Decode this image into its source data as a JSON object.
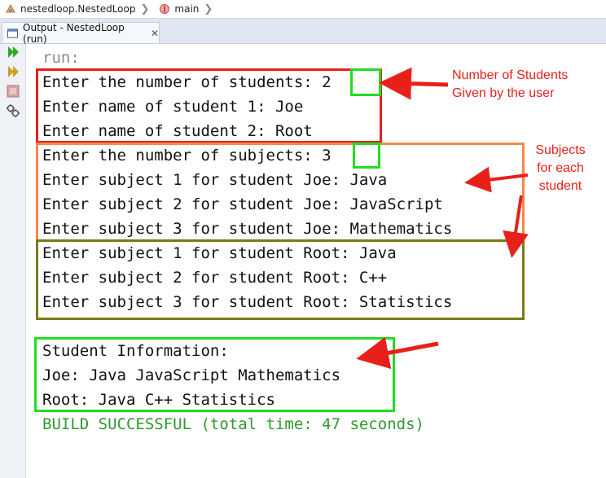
{
  "breadcrumb": {
    "project": "nestedloop.NestedLoop",
    "method": "main"
  },
  "output_tab": {
    "title": "Output - NestedLoop (run)"
  },
  "console": {
    "lines": [
      "run:",
      "Enter the number of students: 2",
      "Enter name of student 1: Joe",
      "Enter name of student 2: Root",
      "Enter the number of subjects: 3",
      "Enter subject 1 for student Joe: Java",
      "Enter subject 2 for student Joe: JavaScript",
      "Enter subject 3 for student Joe: Mathematics",
      "Enter subject 1 for student Root: Java",
      "Enter subject 2 for student Root: C++",
      "Enter subject 3 for student Root: Statistics",
      "",
      "Student Information:",
      "Joe: Java JavaScript Mathematics",
      "Root: Java C++ Statistics",
      "BUILD SUCCESSFUL (total time: 47 seconds)"
    ]
  },
  "annotations": {
    "students_line1": "Number of Students",
    "students_line2": "Given by the user",
    "subjects_line1": "Subjects",
    "subjects_line2": "for each",
    "subjects_line3": "student"
  },
  "colors": {
    "red": "#e8201a",
    "orange": "#f08a4b",
    "olive": "#7a7a1a",
    "green": "#22dd22",
    "build": "#2e9a2e"
  }
}
